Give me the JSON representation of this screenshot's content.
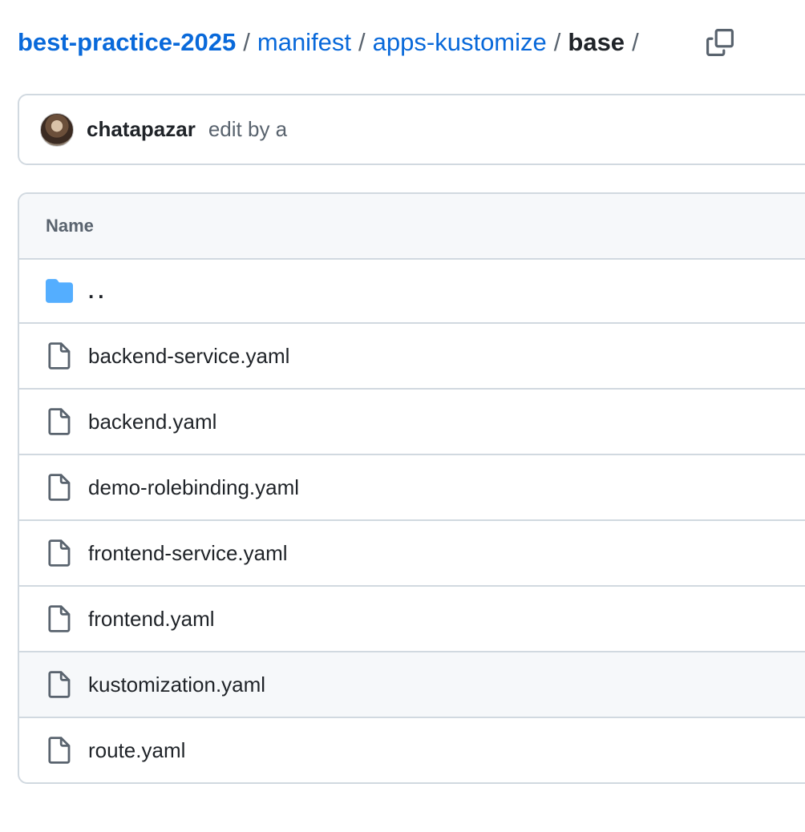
{
  "breadcrumb": {
    "repo": "best-practice-2025",
    "path": [
      "manifest",
      "apps-kustomize"
    ],
    "current": "base",
    "separator": "/",
    "copy_icon": "copy-icon"
  },
  "commit": {
    "author": "chatapazar",
    "message": "edit by a"
  },
  "table": {
    "header": "Name",
    "parent": {
      "label": "..",
      "icon": "folder-icon"
    },
    "files": [
      {
        "label": "backend-service.yaml",
        "icon": "file-icon"
      },
      {
        "label": "backend.yaml",
        "icon": "file-icon"
      },
      {
        "label": "demo-rolebinding.yaml",
        "icon": "file-icon"
      },
      {
        "label": "frontend-service.yaml",
        "icon": "file-icon"
      },
      {
        "label": "frontend.yaml",
        "icon": "file-icon"
      },
      {
        "label": "kustomization.yaml",
        "icon": "file-icon"
      },
      {
        "label": "route.yaml",
        "icon": "file-icon"
      }
    ]
  },
  "colors": {
    "link": "#0969da",
    "muted": "#59636e",
    "border": "#d1d9e0",
    "folder": "#54aeff",
    "header_bg": "#f6f8fa"
  }
}
